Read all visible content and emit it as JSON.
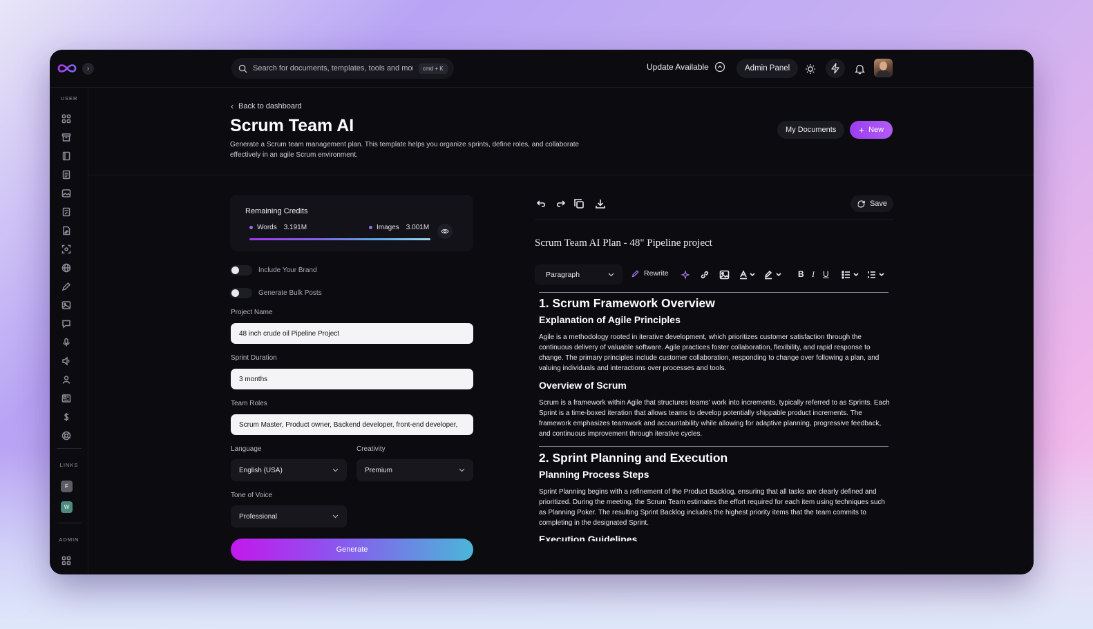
{
  "topbar": {
    "search_placeholder": "Search for documents, templates, tools and more",
    "shortcut": "cmd + K",
    "update_label": "Update Available",
    "admin_panel_label": "Admin Panel"
  },
  "sidebar": {
    "user_label": "USER",
    "links_label": "LINKS",
    "admin_label": "ADMIN",
    "links": [
      {
        "letter": "F",
        "color": "#5c5c66"
      },
      {
        "letter": "W",
        "color": "#4f8a80"
      }
    ]
  },
  "header": {
    "back_label": "Back to dashboard",
    "title": "Scrum Team AI",
    "description": "Generate a Scrum team management plan. This template helps you organize sprints, define roles, and collaborate effectively in an agile Scrum environment.",
    "my_documents_label": "My Documents",
    "new_label": "New"
  },
  "credits": {
    "title": "Remaining Credits",
    "words_label": "Words",
    "words_value": "3.191M",
    "images_label": "Images",
    "images_value": "3.001M"
  },
  "form": {
    "include_brand_label": "Include Your Brand",
    "bulk_posts_label": "Generate Bulk Posts",
    "project_name_label": "Project Name",
    "project_name_value": "48 inch crude oil Pipeline Project",
    "sprint_duration_label": "Sprint Duration",
    "sprint_duration_value": "3 months",
    "team_roles_label": "Team Roles",
    "team_roles_value": "Scrum Master, Product owner, Backend developer, front-end developer,",
    "language_label": "Language",
    "language_value": "English (USA)",
    "creativity_label": "Creativity",
    "creativity_value": "Premium",
    "tone_label": "Tone of Voice",
    "tone_value": "Professional",
    "generate_label": "Generate"
  },
  "editor": {
    "save_label": "Save",
    "doc_title": "Scrum Team AI Plan - 48\" Pipeline project",
    "paragraph_style": "Paragraph",
    "rewrite_label": "Rewrite",
    "sections": {
      "s1_heading": "1. Scrum Framework Overview",
      "s1_sub1": "Explanation of Agile Principles",
      "s1_p1": "Agile is a methodology rooted in iterative development, which prioritizes customer satisfaction through the continuous delivery of valuable software. Agile practices foster collaboration, flexibility, and rapid response to change. The primary principles include customer collaboration, responding to change over following a plan, and valuing individuals and interactions over processes and tools.",
      "s1_sub2": "Overview of Scrum",
      "s1_p2": "Scrum is a framework within Agile that structures teams' work into increments, typically referred to as Sprints. Each Sprint is a time-boxed iteration that allows teams to develop potentially shippable product increments. The framework emphasizes teamwork and accountability while allowing for adaptive planning, progressive feedback, and continuous improvement through iterative cycles.",
      "s2_heading": "2. Sprint Planning and Execution",
      "s2_sub1": "Planning Process Steps",
      "s2_p1": "Sprint Planning begins with a refinement of the Product Backlog, ensuring that all tasks are clearly defined and prioritized. During the meeting, the Scrum Team estimates the effort required for each item using techniques such as Planning Poker. The resulting Sprint Backlog includes the highest priority items that the team commits to completing in the designated Sprint.",
      "s2_sub2": "Execution Guidelines"
    }
  }
}
